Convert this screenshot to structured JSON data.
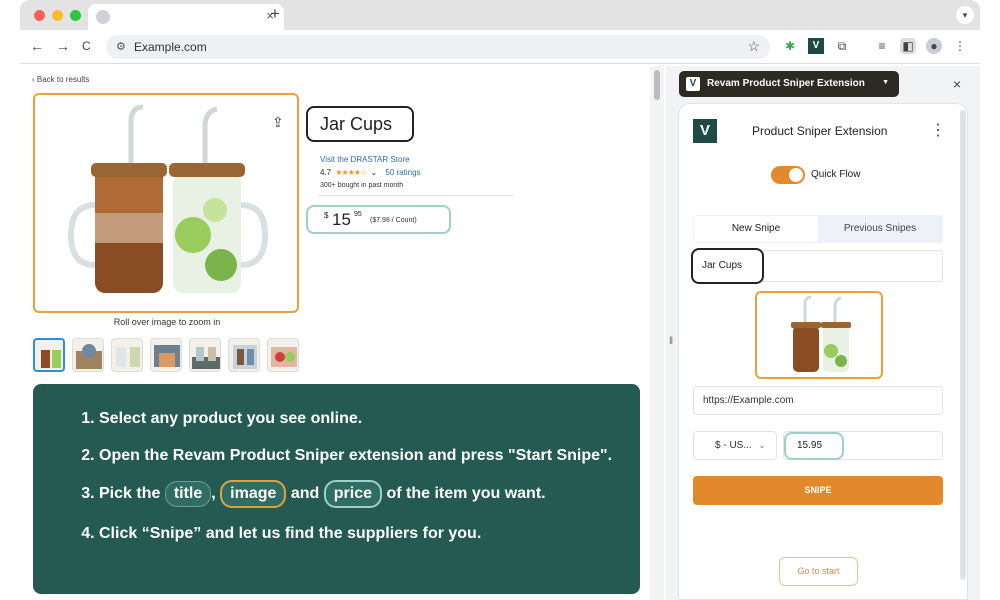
{
  "browser": {
    "tab_close": "×",
    "new_tab": "+",
    "nav": {
      "back": "←",
      "forward": "→",
      "reload": "C"
    },
    "url": "Example.com",
    "star": "☆"
  },
  "product_page": {
    "back_link": "‹ Back to results",
    "title": "Jar Cups",
    "store_link": "Visit the DRASTAR Store",
    "rating_value": "4.7",
    "stars": "★★★★☆",
    "rating_dropdown": "⌄",
    "ratings_count": "50 ratings",
    "bought": "300+ bought in past month",
    "price_currency": "$",
    "price_whole": "15",
    "price_cents": "95",
    "price_unit": "($7.98 / Count)",
    "rollover_text": "Roll over image to zoom in"
  },
  "instructions": {
    "step1": "Select any product you see online.",
    "step2": "Open the Revam Product Sniper extension and press \"Start Snipe\".",
    "step3_prefix": "Pick the",
    "pill_title": "title",
    "comma": ",",
    "pill_image": "image",
    "and": "and",
    "pill_price": "price",
    "step3_suffix": "of the item you want.",
    "step4": "Click “Snipe” and let us find the suppliers for you."
  },
  "side_panel": {
    "ext_select_label": "Revam Product Sniper Extension",
    "close": "×",
    "brand_logo": "V",
    "brand_name": "Product Sniper Extension",
    "quick_flow_label": "Quick Flow",
    "quick_flow_on": true,
    "tabs": [
      "New Snipe",
      "Previous Snipes"
    ],
    "title_value": "Jar Cups",
    "url_value": "https://Example.com",
    "currency_value": "$ - US...",
    "price_value": "15.95",
    "snipe_button": "SNIPE",
    "go_to_start": "Go to start"
  },
  "colors": {
    "accent_orange": "#e28a2b",
    "brand_green": "#1e4c45",
    "instruction_bg": "#245a52",
    "price_outline": "#9fcfca"
  }
}
